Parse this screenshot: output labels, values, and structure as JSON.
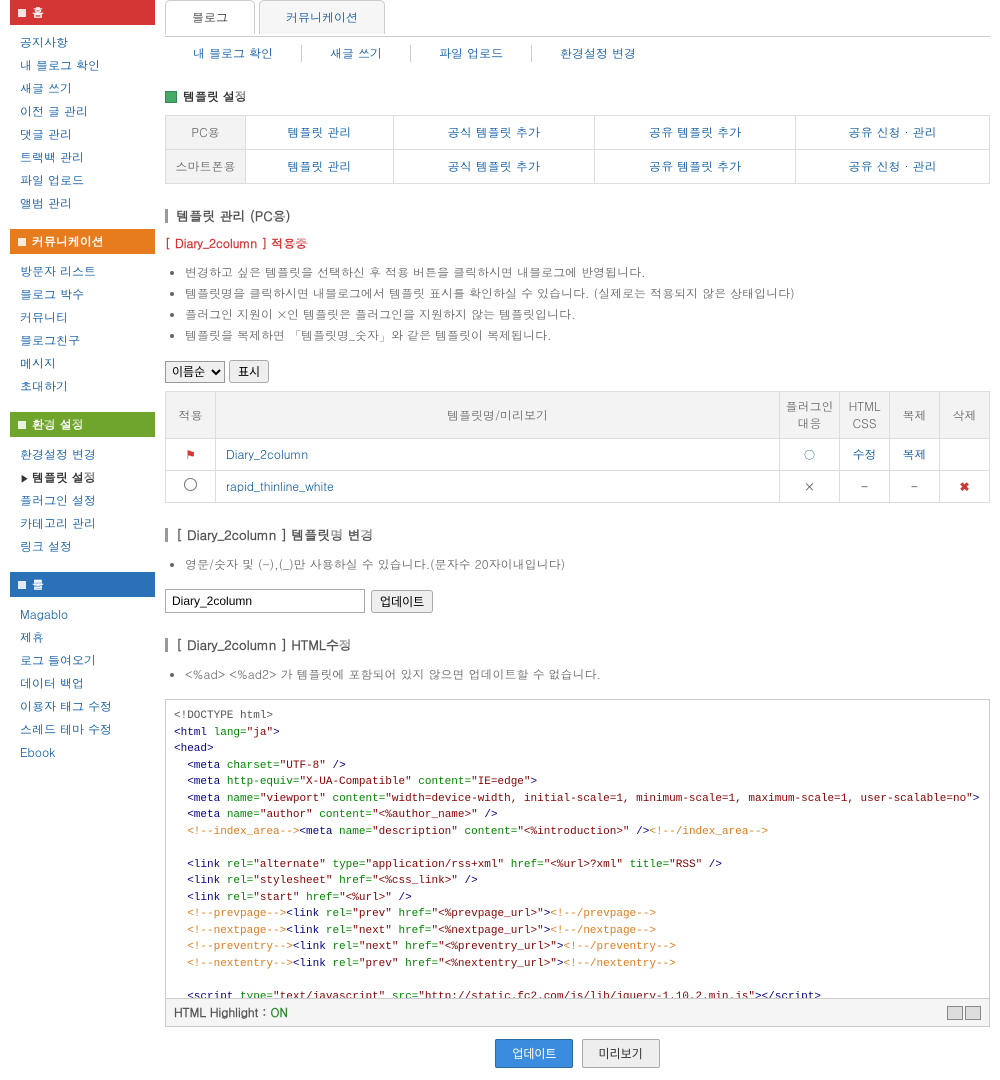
{
  "sidebar": {
    "groups": [
      {
        "color": "red",
        "title": "홈",
        "items": [
          {
            "label": "공지사항"
          },
          {
            "label": "내 블로그 확인"
          },
          {
            "label": "새글 쓰기"
          },
          {
            "label": "이전 글 관리"
          },
          {
            "label": "댓글 관리"
          },
          {
            "label": "트랙백 관리"
          },
          {
            "label": "파일 업로드"
          },
          {
            "label": "앨범 관리"
          }
        ]
      },
      {
        "color": "orange",
        "title": "커뮤니케이션",
        "items": [
          {
            "label": "방문자 리스트"
          },
          {
            "label": "블로그 박수"
          },
          {
            "label": "커뮤니티"
          },
          {
            "label": "블로그친구"
          },
          {
            "label": "메시지"
          },
          {
            "label": "초대하기"
          }
        ]
      },
      {
        "color": "green",
        "title": "환경 설정",
        "items": [
          {
            "label": "환경설정 변경"
          },
          {
            "label": "템플릿 설정",
            "active": true
          },
          {
            "label": "플러그인 설정"
          },
          {
            "label": "카테고리 관리"
          },
          {
            "label": "링크 설정"
          }
        ]
      },
      {
        "color": "blue",
        "title": "툴",
        "items": [
          {
            "label": "Magablo"
          },
          {
            "label": "제휴"
          },
          {
            "label": "로그 들여오기"
          },
          {
            "label": "데이터 백업"
          },
          {
            "label": "이용자 태그 수정"
          },
          {
            "label": "스레드 테마 수정"
          },
          {
            "label": "Ebook"
          }
        ]
      }
    ]
  },
  "tabs": {
    "blog": "블로그",
    "comm": "커뮤니케이션"
  },
  "subnav": {
    "check": "내 블로그 확인",
    "write": "새글 쓰기",
    "upload": "파일 업로드",
    "settings": "환경설정 변경"
  },
  "section_title": "템플릿 설정",
  "tpl_matrix": {
    "rows": [
      {
        "hdr": "PC용",
        "cells": [
          "템플릿 관리",
          "공식 템플릿 추가",
          "공유 템플릿 추가",
          "공유 신청 · 관리"
        ]
      },
      {
        "hdr": "스마트폰용",
        "cells": [
          "템플릿 관리",
          "공식 템플릿 추가",
          "공유 템플릿 추가",
          "공유 신청 · 관리"
        ]
      }
    ]
  },
  "manage": {
    "title": "템플릿 관리 (PC용)",
    "applied_name": "Diary_2column",
    "applied_suffix": "적용중",
    "notes": [
      "변경하고 싶은 템플릿을 선택하신 후 적용 버튼을 클릭하시면 내블로그에 반영됩니다.",
      "템플릿명을 클릭하시면 내블로그에서 템플릿 표시를 확인하실 수 있습니다. (실제로는 적용되지 않은 상태입니다)",
      "플러그인 지원이 ×인 템플릿은 플러그인을 지원하지 않는 템플릿입니다.",
      "템플릿을 복제하면 「템플릿명_숫자」와 같은 템플릿이 복제됩니다."
    ],
    "sort_option": "이름순",
    "sort_btn": "표시",
    "cols": {
      "apply": "적용",
      "name": "템플릿명/미리보기",
      "plugin": "플러그인 대응",
      "html": "HTML CSS",
      "dup": "복제",
      "del": "삭제"
    },
    "rows": [
      {
        "flag": true,
        "name": "Diary_2column",
        "plugin": "○",
        "html": "수정",
        "dup": "복제",
        "del": ""
      },
      {
        "flag": false,
        "name": "rapid_thinline_white",
        "plugin": "×",
        "html": "-",
        "dup": "-",
        "del": "x"
      }
    ]
  },
  "rename": {
    "title_prefix": "[ Diary_2column ]",
    "title": "템플릿명 변경",
    "note": "영문/숫자 및 (-),(_)만 사용하실 수 있습니다.(문자수 20자이내입니다)",
    "value": "Diary_2column",
    "btn": "업데이트"
  },
  "htmledit": {
    "title_prefix": "[ Diary_2column ]",
    "title": "HTML수정",
    "note": "<%ad> <%ad2> 가 템플릿에 포함되어 있지 않으면 업데이트할 수 없습니다.",
    "highlight_label": "HTML Highlight : ",
    "highlight_state": "ON",
    "update_btn": "업데이트",
    "preview_btn": "미리보기"
  }
}
